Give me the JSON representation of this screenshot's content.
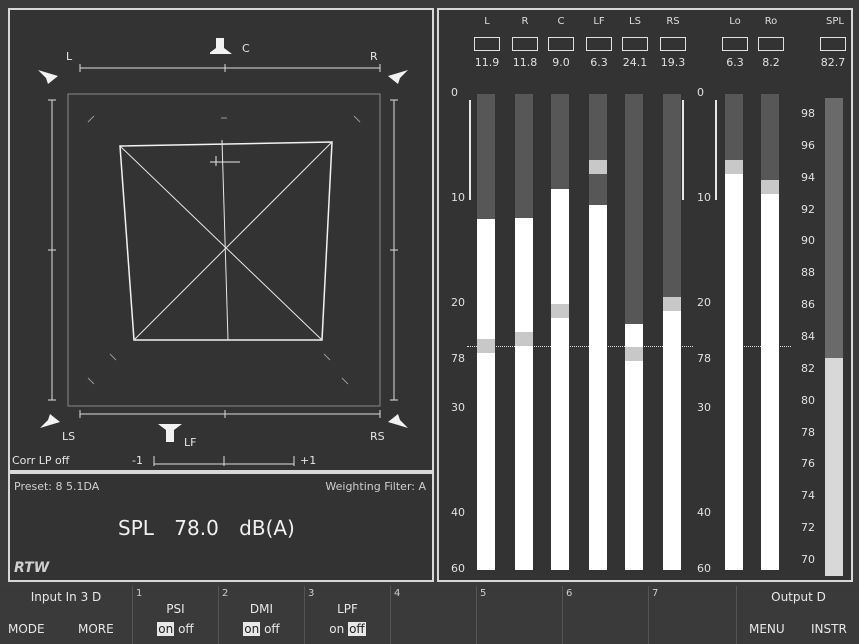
{
  "vectorscope": {
    "speakers": {
      "l": "L",
      "c": "C",
      "r": "R",
      "ls": "LS",
      "lf": "LF",
      "rs": "RS"
    },
    "corr_label": "Corr LP off",
    "corr_min": "-1",
    "corr_max": "+1"
  },
  "info": {
    "preset": "Preset: 8 5.1DA",
    "weighting": "Weighting Filter: A",
    "spl_label": "SPL",
    "spl_value": "78.0",
    "spl_unit": "dB(A)",
    "logo": "RTW"
  },
  "meters": {
    "channels": [
      {
        "name": "L",
        "value": "11.9",
        "fill_db": 11.9,
        "peak_db": 23.3
      },
      {
        "name": "R",
        "value": "11.8",
        "fill_db": 11.8,
        "peak_db": 22.7
      },
      {
        "name": "C",
        "value": "9.0",
        "fill_db": 9.0,
        "peak_db": 20.0
      },
      {
        "name": "LF",
        "value": "6.3",
        "fill_db": 10.6,
        "peak_db": 6.3
      },
      {
        "name": "LS",
        "value": "24.1",
        "fill_db": 21.9,
        "peak_db": 24.1
      },
      {
        "name": "RS",
        "value": "19.3",
        "fill_db": 19.3,
        "peak_db": 19.3
      }
    ],
    "outputs": [
      {
        "name": "Lo",
        "value": "6.3",
        "fill_db": 6.3,
        "peak_db": 6.3
      },
      {
        "name": "Ro",
        "value": "8.2",
        "fill_db": 8.2,
        "peak_db": 8.2
      }
    ],
    "scale_db": [
      "0",
      "10",
      "20",
      "30",
      "40",
      "60"
    ],
    "ref_label": "78",
    "spl": {
      "name": "SPL",
      "value": "82.7",
      "level_db": 82.7,
      "scale": [
        "98",
        "96",
        "94",
        "92",
        "90",
        "88",
        "86",
        "84",
        "82",
        "80",
        "78",
        "76",
        "74",
        "72",
        "70"
      ]
    }
  },
  "bottom": {
    "input_label": "Input In 3 D",
    "mode": "MODE",
    "more": "MORE",
    "slots": [
      {
        "num": "1",
        "label": "PSI",
        "on": "on",
        "off": "off"
      },
      {
        "num": "2",
        "label": "DMI",
        "on": "on",
        "off": "off"
      },
      {
        "num": "3",
        "label": "LPF",
        "on": "on",
        "off": "off"
      },
      {
        "num": "4",
        "label": ""
      },
      {
        "num": "5",
        "label": ""
      },
      {
        "num": "6",
        "label": ""
      },
      {
        "num": "7",
        "label": ""
      }
    ],
    "output_label": "Output D",
    "menu": "MENU",
    "instr": "INSTR"
  }
}
